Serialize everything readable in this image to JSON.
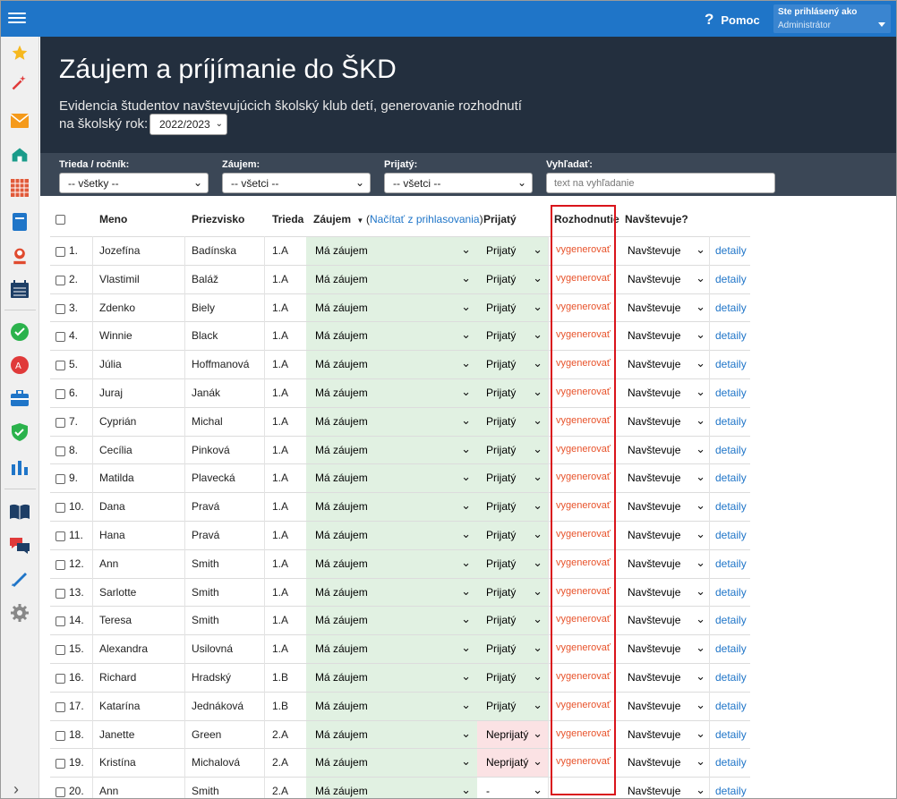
{
  "topbar": {
    "help_label": "Pomoc",
    "help_icon": "?",
    "user_label": "Ste prihlásený ako",
    "user_role": "Administrátor"
  },
  "sidebar": {
    "icons": [
      "star-icon",
      "magic-wand-icon",
      "mail-icon",
      "home-icon",
      "timetable-icon",
      "book-icon",
      "user-icon",
      "calendar-icon",
      "check-icon",
      "grade-icon",
      "briefcase-icon",
      "shield-icon",
      "chart-icon",
      "open-book-icon",
      "chat-icon",
      "pen-icon",
      "gear-icon",
      "chevron-right-icon"
    ]
  },
  "header": {
    "title": "Záujem a príjímanie do ŠKD",
    "subtitle": "Evidencia študentov navštevujúcich školský klub detí, generovanie rozhodnutí",
    "year_label": "na školský rok:",
    "year_value": "2022/2023"
  },
  "filters": {
    "trieda_label": "Trieda / ročník:",
    "trieda_value": "-- všetky --",
    "zaujem_label": "Záujem:",
    "zaujem_value": "-- všetci --",
    "prijaty_label": "Prijatý:",
    "prijaty_value": "-- všetci --",
    "search_label": "Vyhľadať:",
    "search_placeholder": "text na vyhľadanie"
  },
  "table": {
    "headers": {
      "meno": "Meno",
      "priezvisko": "Priezvisko",
      "trieda": "Trieda",
      "zaujem": "Záujem",
      "nacitat": "Načítať z prihlasovania",
      "prijaty": "Prijatý",
      "rozhodnutie": "Rozhodnutie",
      "navstevuje": "Navštevuje?"
    },
    "generate_label": "vygenerovať",
    "details_label": "detaily",
    "rows": [
      {
        "n": "1.",
        "meno": "Jozefína",
        "priezvisko": "Badínska",
        "trieda": "1.A",
        "zaujem": "Má záujem",
        "prijaty": "Prijatý",
        "status": "yes",
        "gen": "vygenerovať",
        "nav": "Navštevuje"
      },
      {
        "n": "2.",
        "meno": "Vlastimil",
        "priezvisko": "Baláž",
        "trieda": "1.A",
        "zaujem": "Má záujem",
        "prijaty": "Prijatý",
        "status": "yes",
        "gen": "vygenerovať",
        "nav": "Navštevuje"
      },
      {
        "n": "3.",
        "meno": "Zdenko",
        "priezvisko": "Biely",
        "trieda": "1.A",
        "zaujem": "Má záujem",
        "prijaty": "Prijatý",
        "status": "yes",
        "gen": "vygenerovať",
        "nav": "Navštevuje"
      },
      {
        "n": "4.",
        "meno": "Winnie",
        "priezvisko": "Black",
        "trieda": "1.A",
        "zaujem": "Má záujem",
        "prijaty": "Prijatý",
        "status": "yes",
        "gen": "vygenerovať",
        "nav": "Navštevuje"
      },
      {
        "n": "5.",
        "meno": "Júlia",
        "priezvisko": "Hoffmanová",
        "trieda": "1.A",
        "zaujem": "Má záujem",
        "prijaty": "Prijatý",
        "status": "yes",
        "gen": "vygenerovať",
        "nav": "Navštevuje"
      },
      {
        "n": "6.",
        "meno": "Juraj",
        "priezvisko": "Janák",
        "trieda": "1.A",
        "zaujem": "Má záujem",
        "prijaty": "Prijatý",
        "status": "yes",
        "gen": "vygenerovať",
        "nav": "Navštevuje"
      },
      {
        "n": "7.",
        "meno": "Cyprián",
        "priezvisko": "Michal",
        "trieda": "1.A",
        "zaujem": "Má záujem",
        "prijaty": "Prijatý",
        "status": "yes",
        "gen": "vygenerovať",
        "nav": "Navštevuje"
      },
      {
        "n": "8.",
        "meno": "Cecília",
        "priezvisko": "Pinková",
        "trieda": "1.A",
        "zaujem": "Má záujem",
        "prijaty": "Prijatý",
        "status": "yes",
        "gen": "vygenerovať",
        "nav": "Navštevuje"
      },
      {
        "n": "9.",
        "meno": "Matilda",
        "priezvisko": "Plavecká",
        "trieda": "1.A",
        "zaujem": "Má záujem",
        "prijaty": "Prijatý",
        "status": "yes",
        "gen": "vygenerovať",
        "nav": "Navštevuje"
      },
      {
        "n": "10.",
        "meno": "Dana",
        "priezvisko": "Pravá",
        "trieda": "1.A",
        "zaujem": "Má záujem",
        "prijaty": "Prijatý",
        "status": "yes",
        "gen": "vygenerovať",
        "nav": "Navštevuje"
      },
      {
        "n": "11.",
        "meno": "Hana",
        "priezvisko": "Pravá",
        "trieda": "1.A",
        "zaujem": "Má záujem",
        "prijaty": "Prijatý",
        "status": "yes",
        "gen": "vygenerovať",
        "nav": "Navštevuje"
      },
      {
        "n": "12.",
        "meno": "Ann",
        "priezvisko": "Smith",
        "trieda": "1.A",
        "zaujem": "Má záujem",
        "prijaty": "Prijatý",
        "status": "yes",
        "gen": "vygenerovať",
        "nav": "Navštevuje"
      },
      {
        "n": "13.",
        "meno": "Sarlotte",
        "priezvisko": "Smith",
        "trieda": "1.A",
        "zaujem": "Má záujem",
        "prijaty": "Prijatý",
        "status": "yes",
        "gen": "vygenerovať",
        "nav": "Navštevuje"
      },
      {
        "n": "14.",
        "meno": "Teresa",
        "priezvisko": "Smith",
        "trieda": "1.A",
        "zaujem": "Má záujem",
        "prijaty": "Prijatý",
        "status": "yes",
        "gen": "vygenerovať",
        "nav": "Navštevuje"
      },
      {
        "n": "15.",
        "meno": "Alexandra",
        "priezvisko": "Usilovná",
        "trieda": "1.A",
        "zaujem": "Má záujem",
        "prijaty": "Prijatý",
        "status": "yes",
        "gen": "vygenerovať",
        "nav": "Navštevuje"
      },
      {
        "n": "16.",
        "meno": "Richard",
        "priezvisko": "Hradský",
        "trieda": "1.B",
        "zaujem": "Má záujem",
        "prijaty": "Prijatý",
        "status": "yes",
        "gen": "vygenerovať",
        "nav": "Navštevuje"
      },
      {
        "n": "17.",
        "meno": "Katarína",
        "priezvisko": "Jednáková",
        "trieda": "1.B",
        "zaujem": "Má záujem",
        "prijaty": "Prijatý",
        "status": "yes",
        "gen": "vygenerovať",
        "nav": "Navštevuje"
      },
      {
        "n": "18.",
        "meno": "Janette",
        "priezvisko": "Green",
        "trieda": "2.A",
        "zaujem": "Má záujem",
        "prijaty": "Neprijatý",
        "status": "no",
        "gen": "vygenerovať",
        "nav": "Navštevuje"
      },
      {
        "n": "19.",
        "meno": "Kristína",
        "priezvisko": "Michalová",
        "trieda": "2.A",
        "zaujem": "Má záujem",
        "prijaty": "Neprijatý",
        "status": "no",
        "gen": "vygenerovať",
        "nav": "Navštevuje"
      },
      {
        "n": "20.",
        "meno": "Ann",
        "priezvisko": "Smith",
        "trieda": "2.A",
        "zaujem": "Má záujem",
        "prijaty": "-",
        "status": "none",
        "gen": "",
        "nav": "Navštevuje"
      }
    ]
  },
  "colors": {
    "topbar": "#1f75c8",
    "header": "#232f3e",
    "filterbar": "#3b4756",
    "accepted_bg": "#e1f1e2",
    "rejected_bg": "#fbe2e4",
    "generate_link": "#e8532b",
    "details_link": "#1f75c8",
    "highlight": "#d9141b"
  }
}
